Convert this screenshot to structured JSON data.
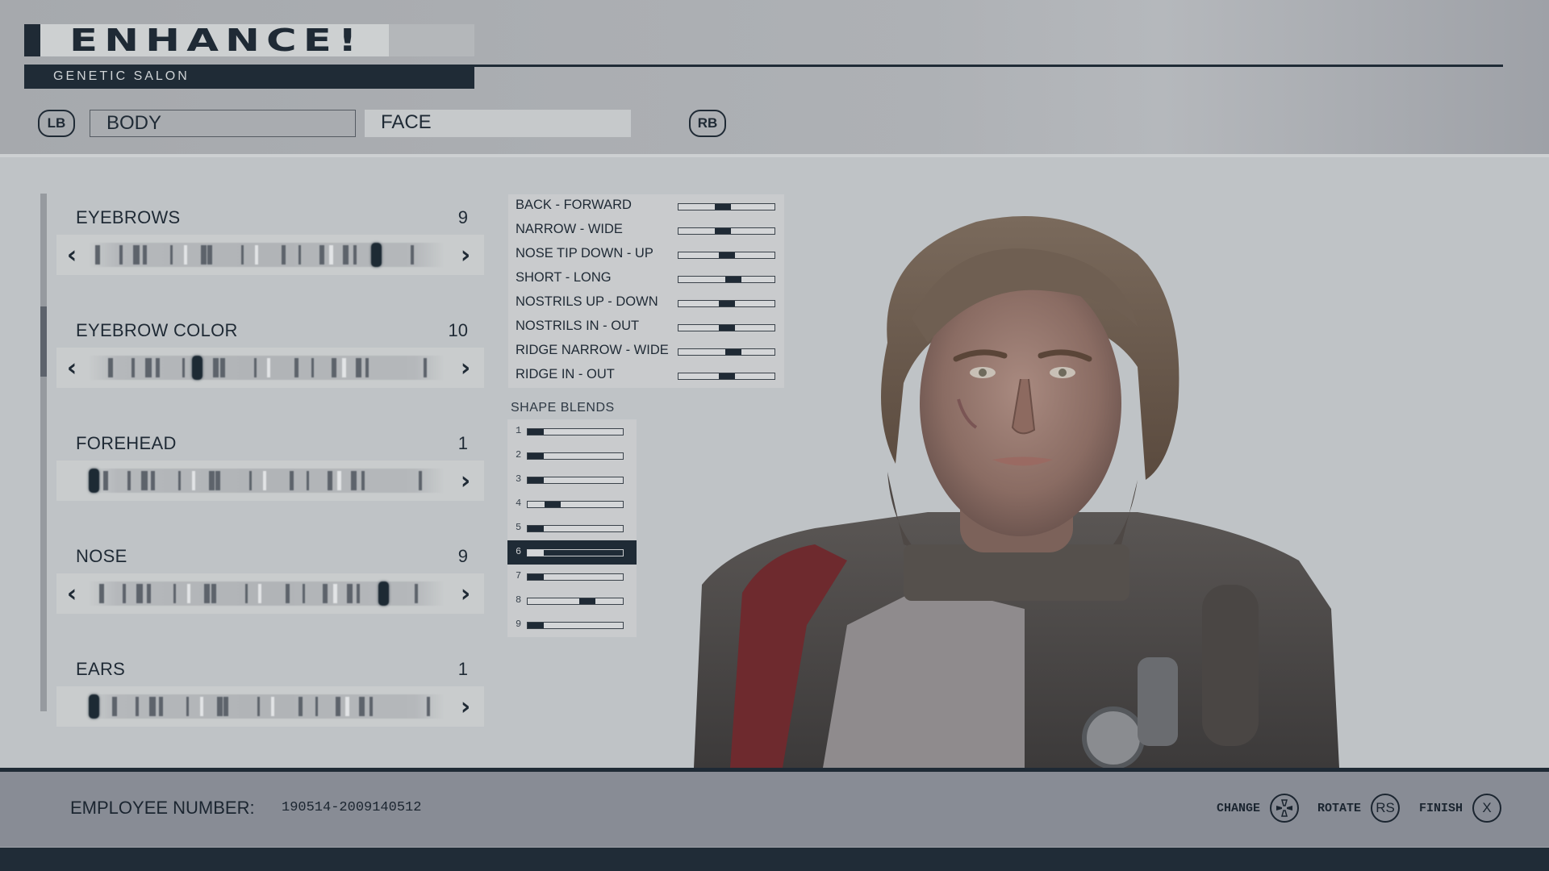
{
  "header": {
    "title": "ENHANCE!",
    "subtitle": "GENETIC SALON",
    "tabs": [
      {
        "label": "BODY",
        "active": false
      },
      {
        "label": "FACE",
        "active": true
      }
    ],
    "prev_bumper": "LB",
    "next_bumper": "RB"
  },
  "morphs": [
    {
      "label": "EYEBROWS",
      "value": "9",
      "position": 0.82,
      "has_left_arrow": true,
      "has_right_arrow": true
    },
    {
      "label": "EYEBROW COLOR",
      "value": "10",
      "position": 0.3,
      "has_left_arrow": true,
      "has_right_arrow": true
    },
    {
      "label": "FOREHEAD",
      "value": "1",
      "position": 0.0,
      "has_left_arrow": false,
      "has_right_arrow": true
    },
    {
      "label": "NOSE",
      "value": "9",
      "position": 0.84,
      "has_left_arrow": true,
      "has_right_arrow": true
    },
    {
      "label": "EARS",
      "value": "1",
      "position": 0.0,
      "has_left_arrow": false,
      "has_right_arrow": true
    }
  ],
  "morph_scroll": {
    "visible_fraction": 0.14,
    "offset_fraction": 0.22
  },
  "nose_details": [
    {
      "label": "BACK - FORWARD",
      "value": 0.45
    },
    {
      "label": "NARROW - WIDE",
      "value": 0.45
    },
    {
      "label": "NOSE TIP DOWN - UP",
      "value": 0.5
    },
    {
      "label": "SHORT - LONG",
      "value": 0.59
    },
    {
      "label": "NOSTRILS UP - DOWN",
      "value": 0.5
    },
    {
      "label": "NOSTRILS IN - OUT",
      "value": 0.5
    },
    {
      "label": "RIDGE NARROW - WIDE",
      "value": 0.59
    },
    {
      "label": "RIDGE IN - OUT",
      "value": 0.5
    }
  ],
  "shape_blends": {
    "title": "SHAPE BLENDS",
    "items": [
      {
        "num": "1",
        "value": 0.0,
        "selected": false
      },
      {
        "num": "2",
        "value": 0.0,
        "selected": false
      },
      {
        "num": "3",
        "value": 0.0,
        "selected": false
      },
      {
        "num": "4",
        "value": 0.21,
        "selected": false
      },
      {
        "num": "5",
        "value": 0.0,
        "selected": false
      },
      {
        "num": "6",
        "value": 0.0,
        "selected": true
      },
      {
        "num": "7",
        "value": 0.0,
        "selected": false
      },
      {
        "num": "8",
        "value": 0.65,
        "selected": false
      },
      {
        "num": "9",
        "value": 0.0,
        "selected": false
      }
    ]
  },
  "footer": {
    "employee_label": "EMPLOYEE NUMBER:",
    "employee_number": "190514-2009140512",
    "prompts": [
      {
        "label": "CHANGE",
        "button": "dpad-icon"
      },
      {
        "label": "ROTATE",
        "button": "RS"
      },
      {
        "label": "FINISH",
        "button": "X"
      }
    ]
  },
  "colors": {
    "dark": "#1f2a35",
    "panel": "#c9cbcd",
    "background": "#bfc3c6",
    "footer": "#888c95"
  }
}
